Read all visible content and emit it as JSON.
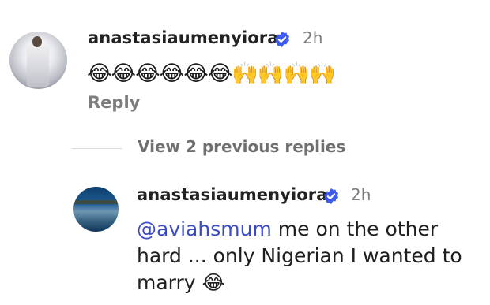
{
  "comment": {
    "username": "anastasiaumenyiora",
    "time": "2h",
    "emojis": "😂😂😂😂😂😂🙌🙌🙌🙌",
    "reply_label": "Reply"
  },
  "thread": {
    "view_replies_label": "View 2 previous replies"
  },
  "reply": {
    "username": "anastasiaumenyiora",
    "time": "2h",
    "mention": "@aviahsmum",
    "text": " me on the other hard ... only Nigerian I wanted to marry ",
    "emoji": "😂"
  },
  "colors": {
    "verified": "#3d5af1",
    "mention": "#3b4bc7",
    "muted": "#7d7d7d"
  }
}
